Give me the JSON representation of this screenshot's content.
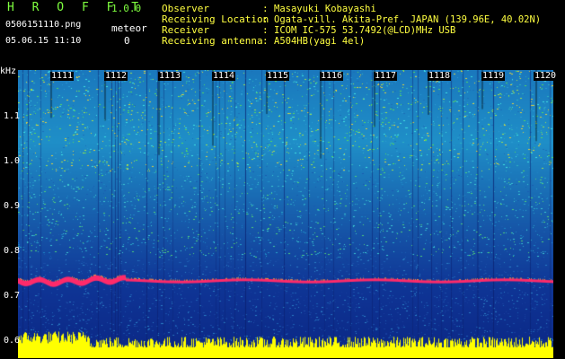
{
  "header": {
    "app_title": "H R O F F T",
    "version": "1.0.0",
    "file_name": "0506151110.png",
    "meteor_label": "meteor",
    "datetime": "05.06.15 11:10",
    "meteor_count": "0",
    "info": [
      {
        "key": "Observer",
        "value": "Masayuki Kobayashi"
      },
      {
        "key": "Receiving Location",
        "value": "Ogata-vill. Akita-Pref. JAPAN (139.96E, 40.02N)"
      },
      {
        "key": "Receiver",
        "value": "ICOM IC-575 53.7492(@LCD)MHz USB"
      },
      {
        "key": "Receiving antenna",
        "value": "A504HB(yagi 4el)"
      }
    ]
  },
  "spectrogram": {
    "y_unit": "kHz",
    "y_ticks": [
      "1.1",
      "1.0",
      "0.9",
      "0.8",
      "0.7",
      "0.6"
    ],
    "time_labels": [
      "1111",
      "1112",
      "1113",
      "1114",
      "1115",
      "1116",
      "1117",
      "1118",
      "1119",
      "1120"
    ],
    "signal_frequency_khz": 0.735,
    "colors": {
      "background_top": "#1f8fc8",
      "background_bottom": "#0b2784",
      "signal": "#ff2a6a",
      "noise_floor": "#ffff00",
      "speckle_green": "#55d860",
      "speckle_cyan": "#40e0e0"
    }
  }
}
